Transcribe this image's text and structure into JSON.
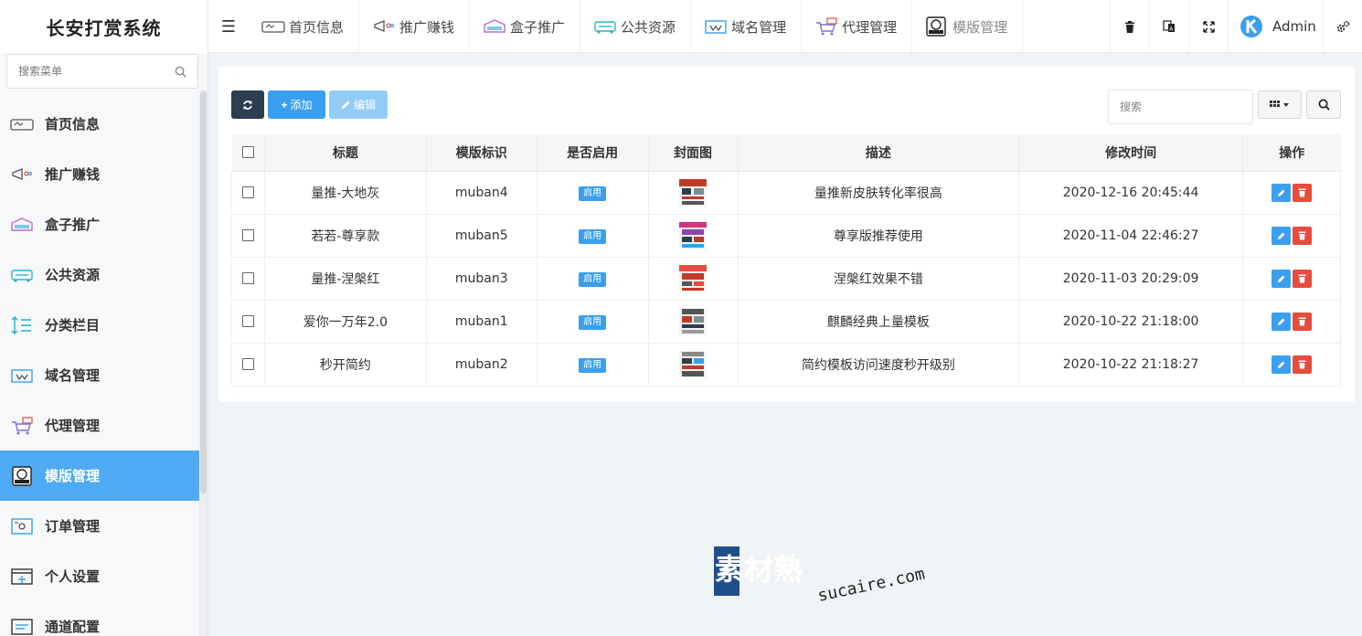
{
  "app": {
    "title": "长安打赏系统"
  },
  "sidebar": {
    "search_placeholder": "搜索菜单",
    "items": [
      {
        "label": "首页信息",
        "icon": "home-card-icon"
      },
      {
        "label": "推广赚钱",
        "icon": "megaphone-icon"
      },
      {
        "label": "盒子推广",
        "icon": "box-icon"
      },
      {
        "label": "公共资源",
        "icon": "resource-icon"
      },
      {
        "label": "分类栏目",
        "icon": "category-icon"
      },
      {
        "label": "域名管理",
        "icon": "domain-icon"
      },
      {
        "label": "代理管理",
        "icon": "agent-cart-icon"
      },
      {
        "label": "模版管理",
        "icon": "html-template-icon",
        "active": true
      },
      {
        "label": "订单管理",
        "icon": "order-icon"
      },
      {
        "label": "个人设置",
        "icon": "settings-window-icon"
      },
      {
        "label": "通道配置",
        "icon": "channel-icon"
      }
    ]
  },
  "topbar": {
    "tabs": [
      {
        "label": "首页信息",
        "icon": "home-card-icon"
      },
      {
        "label": "推广赚钱",
        "icon": "megaphone-icon"
      },
      {
        "label": "盒子推广",
        "icon": "box-icon"
      },
      {
        "label": "公共资源",
        "icon": "resource-icon"
      },
      {
        "label": "域名管理",
        "icon": "domain-icon"
      },
      {
        "label": "代理管理",
        "icon": "agent-cart-icon"
      },
      {
        "label": "模版管理",
        "icon": "html-template-icon",
        "current": true
      }
    ],
    "user": {
      "name": "Admin"
    }
  },
  "toolbar": {
    "add_label": "添加",
    "edit_label": "编辑",
    "search_placeholder": "搜索"
  },
  "table": {
    "columns": [
      "标题",
      "模版标识",
      "是否启用",
      "封面图",
      "描述",
      "修改时间",
      "操作"
    ],
    "rows": [
      {
        "title": "量推-大地灰",
        "key": "muban4",
        "enabled": "启用",
        "desc": "量推新皮肤转化率很高",
        "time": "2020-12-16 20:45:44"
      },
      {
        "title": "若若-尊享款",
        "key": "muban5",
        "enabled": "启用",
        "desc": "尊享版推荐使用",
        "time": "2020-11-04 22:46:27"
      },
      {
        "title": "量推-涅槃红",
        "key": "muban3",
        "enabled": "启用",
        "desc": "涅槃红效果不错",
        "time": "2020-11-03 20:29:09"
      },
      {
        "title": "爱你一万年2.0",
        "key": "muban1",
        "enabled": "启用",
        "desc": "麒麟经典上量模板",
        "time": "2020-10-22 21:18:00"
      },
      {
        "title": "秒开简约",
        "key": "muban2",
        "enabled": "启用",
        "desc": "简约模板访问速度秒开级别",
        "time": "2020-10-22 21:18:27"
      }
    ]
  },
  "watermark": {
    "brand": "素材熟",
    "domain": "sucaire.com"
  },
  "colors": {
    "primary": "#3a9fef",
    "active_menu": "#4eaaf3",
    "dark_button": "#2c3e50",
    "danger": "#e74c3c"
  }
}
